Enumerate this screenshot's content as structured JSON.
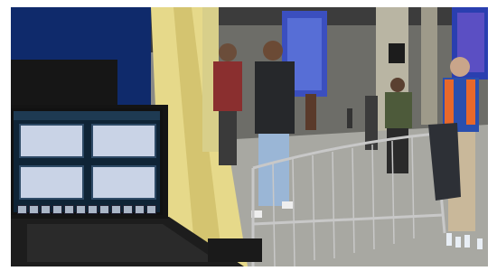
{
  "scene": {
    "description_free": true,
    "colors": {
      "left_wall": "#0f2a6b",
      "curtain": "#e6d98a",
      "pillar": "#d8cf8a",
      "floor": "#a8a8a2",
      "ceiling": "#3c3c3c",
      "led_panel": "#3b4fbf",
      "led_panel_right": "#2a3fb0",
      "laptop_body": "#1d1d1d",
      "laptop_screen": "#0f2436",
      "fence": "#bfbfbf",
      "vest_orange": "#e8682b",
      "jacket_blue": "#2a4fae"
    }
  },
  "laptop_ui": {
    "tabs": [
      "",
      ""
    ],
    "thumbnail_count": 4,
    "strip_cells": 12
  }
}
